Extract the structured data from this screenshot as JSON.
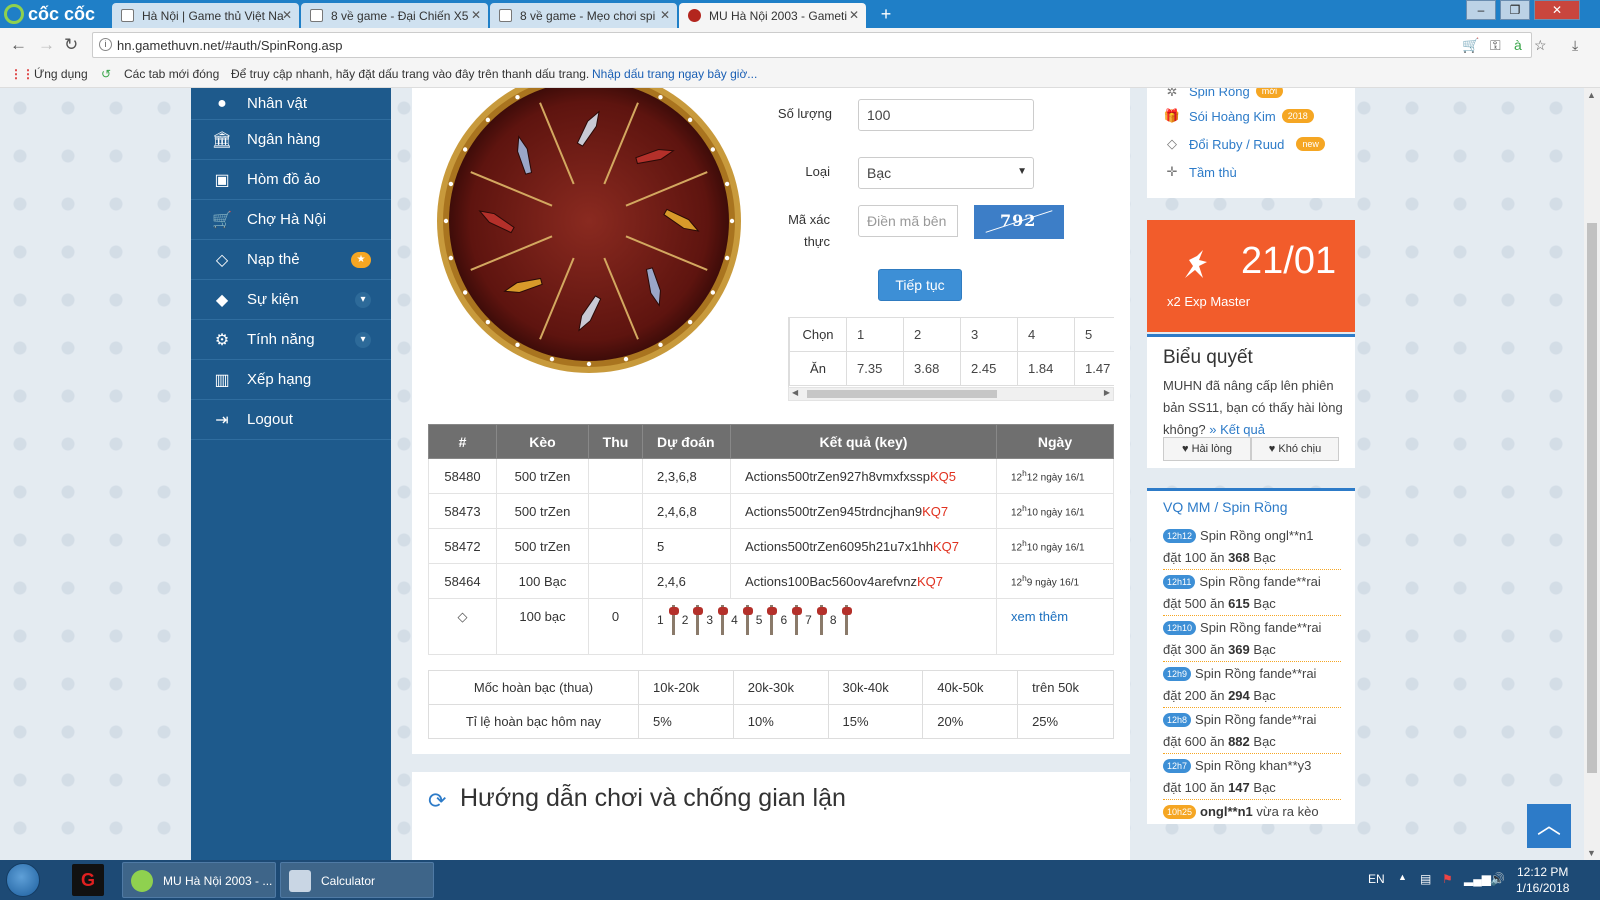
{
  "browser": {
    "brand": "cốc cốc",
    "tabs": [
      {
        "title": "Hà Nội | Game thủ Việt Na"
      },
      {
        "title": "8 về game - Đại Chiến X5"
      },
      {
        "title": "8 về game - Mẹo chơi spi"
      },
      {
        "title": "MU Hà Nội 2003 - Gameti"
      }
    ],
    "url": "hn.gamethuvn.net/#auth/SpinRong.asp",
    "bookmarks": {
      "apps": "Ứng dụng",
      "recent": "Các tab mới đóng",
      "hint": "Để truy cập nhanh, hãy đặt dấu trang vào đây trên thanh dấu trang.",
      "import": "Nhập dấu trang ngay bây giờ..."
    }
  },
  "leftnav": {
    "items": [
      {
        "label": "Nhân vật",
        "icon": "user-icon"
      },
      {
        "label": "Ngân hàng",
        "icon": "bank-icon"
      },
      {
        "label": "Hòm đồ ảo",
        "icon": "briefcase-icon"
      },
      {
        "label": "Chợ Hà Nội",
        "icon": "cart-icon"
      },
      {
        "label": "Nạp thẻ",
        "icon": "diamond-icon"
      },
      {
        "label": "Sự kiện",
        "icon": "android-icon"
      },
      {
        "label": "Tính năng",
        "icon": "cogs-icon"
      },
      {
        "label": "Xếp hạng",
        "icon": "bar-chart-icon"
      },
      {
        "label": "Logout",
        "icon": "sign-out-icon"
      }
    ]
  },
  "form": {
    "quantity_label": "Số lượng",
    "quantity_value": "100",
    "type_label": "Loại",
    "type_value": "Bạc",
    "captcha_label": "Mã xác thực",
    "captcha_placeholder": "Điền mã bên",
    "captcha_text": "792",
    "submit": "Tiếp tục"
  },
  "odds": {
    "row1_label": "Chọn",
    "row2_label": "Ăn",
    "choices": [
      "1",
      "2",
      "3",
      "4",
      "5"
    ],
    "payouts": [
      "7.35",
      "3.68",
      "2.45",
      "1.84",
      "1.47"
    ]
  },
  "history": {
    "headers": [
      "#",
      "Kèo",
      "Thu",
      "Dự đoán",
      "Kết quả (key)",
      "Ngày"
    ],
    "rows": [
      {
        "id": "58480",
        "keo": "500 trZen",
        "thu": "",
        "predict": "2,3,6,8",
        "key": "Actions500trZen927h8vmxfxssp",
        "kq": "KQ5",
        "date_h": "12",
        "date_rest": "12 ngày 16/1"
      },
      {
        "id": "58473",
        "keo": "500 trZen",
        "thu": "",
        "predict": "2,4,6,8",
        "key": "Actions500trZen945trdncjhan9",
        "kq": "KQ7",
        "date_h": "12",
        "date_rest": "10 ngày 16/1"
      },
      {
        "id": "58472",
        "keo": "500 trZen",
        "thu": "",
        "predict": "5",
        "key": "Actions500trZen6095h21u7x1hh",
        "kq": "KQ7",
        "date_h": "12",
        "date_rest": "10 ngày 16/1"
      },
      {
        "id": "58464",
        "keo": "100 Bạc",
        "thu": "",
        "predict": "2,4,6",
        "key": "Actions100Bac560ov4arefvnz",
        "kq": "KQ7",
        "date_h": "12",
        "date_rest": "9 ngày 16/1"
      }
    ],
    "last": {
      "keo": "100 bạc",
      "thu": "0",
      "items": [
        "1",
        "2",
        "3",
        "4",
        "5",
        "6",
        "7",
        "8"
      ],
      "more": "xem thêm"
    }
  },
  "refund": {
    "row1_label": "Mốc hoàn bạc (thua)",
    "row2_label": "Tỉ lệ hoàn bạc hôm nay",
    "tiers": [
      "10k-20k",
      "20k-30k",
      "30k-40k",
      "40k-50k",
      "trên 50k"
    ],
    "rates": [
      "5%",
      "10%",
      "15%",
      "20%",
      "25%"
    ]
  },
  "guide": {
    "title": "Hướng dẫn chơi và chống gian lận"
  },
  "right": {
    "links": [
      {
        "label": "Spin Rồng",
        "badge": "mới"
      },
      {
        "label": "Sói Hoàng Kim",
        "badge": "2018"
      },
      {
        "label": "Đổi Ruby / Ruud",
        "badge": "new"
      },
      {
        "label": "Tầm thù",
        "badge": ""
      }
    ],
    "promo": {
      "date": "21/01",
      "text": "x2 Exp Master"
    },
    "poll": {
      "title": "Biểu quyết",
      "text": "MUHN đã nâng cấp lên phiên bản SS11, bạn có thấy hài lòng không?",
      "result_link": "» Kết quả",
      "like": "Hài lòng",
      "dislike": "Khó chịu"
    },
    "feed": {
      "title": "VQ MM / Spin Rồng",
      "items": [
        {
          "time": "12h12",
          "text": "Spin Rồng ongl**n1",
          "bet": "đặt 100 ăn",
          "win": "368",
          "unit": "Bạc"
        },
        {
          "time": "12h11",
          "text": "Spin Rồng fande**rai",
          "bet": "đặt 500 ăn",
          "win": "615",
          "unit": "Bạc"
        },
        {
          "time": "12h10",
          "text": "Spin Rồng fande**rai",
          "bet": "đặt 300 ăn",
          "win": "369",
          "unit": "Bạc"
        },
        {
          "time": "12h9",
          "text": "Spin Rồng fande**rai",
          "bet": "đặt 200 ăn",
          "win": "294",
          "unit": "Bạc"
        },
        {
          "time": "12h8",
          "text": "Spin Rồng fande**rai",
          "bet": "đặt 600 ăn",
          "win": "882",
          "unit": "Bạc"
        },
        {
          "time": "12h7",
          "text": "Spin Rồng khan**y3",
          "bet": "đặt 100 ăn",
          "win": "147",
          "unit": "Bạc"
        }
      ],
      "last": {
        "time": "10h25",
        "user": "ongl**n1",
        "text": "vừa ra kèo"
      }
    }
  },
  "taskbar": {
    "apps": [
      {
        "label": "MU Hà Nội 2003 - ..."
      },
      {
        "label": "Calculator"
      }
    ],
    "lang": "EN",
    "time": "12:12 PM",
    "date": "1/16/2018"
  }
}
